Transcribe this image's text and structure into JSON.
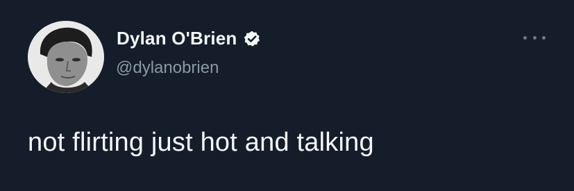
{
  "tweet": {
    "display_name": "Dylan O'Brien",
    "handle": "@dylanobrien",
    "text": "not flirting just hot and talking",
    "verified": true
  },
  "icons": {
    "verified": "verified-badge-icon",
    "more": "more-horizontal-icon",
    "avatar": "profile-photo"
  },
  "colors": {
    "background": "#151d2a",
    "primary_text": "#f5f8fa",
    "secondary_text": "#8b98a5"
  }
}
